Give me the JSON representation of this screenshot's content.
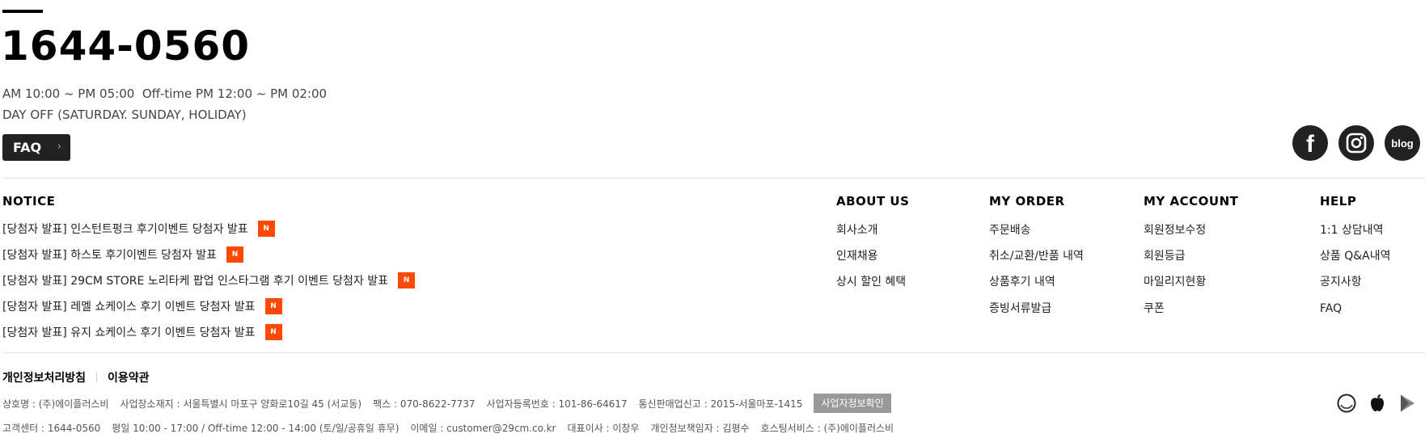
{
  "contact": {
    "phone": "1644-0560",
    "hours": "AM 10:00 ~ PM 05:00  Off-time PM 12:00 ~ PM 02:00",
    "day_off": "DAY OFF (SATURDAY. SUNDAY, HOLIDAY)",
    "faq_label": "FAQ"
  },
  "social": {
    "icons": [
      "facebook-icon",
      "instagram-icon",
      "blog-icon"
    ],
    "facebook_glyph": "f",
    "blog_label": "blog"
  },
  "notice": {
    "title": "NOTICE",
    "badge": "N",
    "items": [
      "[당첨자 발표] 인스턴트펑크 후기이벤트 당첨자 발표",
      "[당첨자 발표] 하스토 후기이벤트 당첨자 발표",
      "[당첨자 발표] 29CM STORE 노리타케 팝업 인스타그램 후기 이벤트 당첨자 발표",
      "[당첨자 발표] 레멜 쇼케이스 후기 이벤트 당첨자 발표",
      "[당첨자 발표] 유지 쇼케이스 후기 이벤트 당첨자 발표"
    ]
  },
  "about_us": {
    "title": "ABOUT US",
    "links": [
      "회사소개",
      "인재채용",
      "상시 할인 혜택"
    ]
  },
  "my_order": {
    "title": "MY ORDER",
    "links": [
      "주문배송",
      "취소/교환/반품 내역",
      "상품후기 내역",
      "증빙서류발급"
    ]
  },
  "my_account": {
    "title": "MY ACCOUNT",
    "links": [
      "회원정보수정",
      "회원등급",
      "마일리지현황",
      "쿠폰"
    ]
  },
  "help": {
    "title": "HELP",
    "links": [
      "1:1 상담내역",
      "상품 Q&A내역",
      "공지사항",
      "FAQ"
    ]
  },
  "policy": {
    "privacy": "개인정보처리방침",
    "terms": "이용약관"
  },
  "company": {
    "line1": [
      "상호명 : (주)에이플러스비",
      "사업장소재지 : 서울특별시 마포구 양화로10길 45 (서교동)",
      "팩스 : 070-8622-7737",
      "사업자등록번호 : 101-86-64617",
      "통신판매업신고 : 2015-서울마포-1415"
    ],
    "biz_check_button": "사업자정보확인",
    "line2": [
      "고객센터 : 1644-0560",
      "평일 10:00 - 17:00 / Off-time 12:00 - 14:00 (토/일/공휴일 휴무)",
      "이메일 : customer@29cm.co.kr",
      "대표이사 : 이창우",
      "개인정보책임자 : 김평수",
      "호스팅서비스 : (주)에이플러스비"
    ]
  },
  "apps": [
    "circle-icon",
    "apple-icon",
    "play-icon"
  ],
  "colors": {
    "badge": "#ff4800",
    "dark": "#222222",
    "biz_button": "#999999"
  }
}
